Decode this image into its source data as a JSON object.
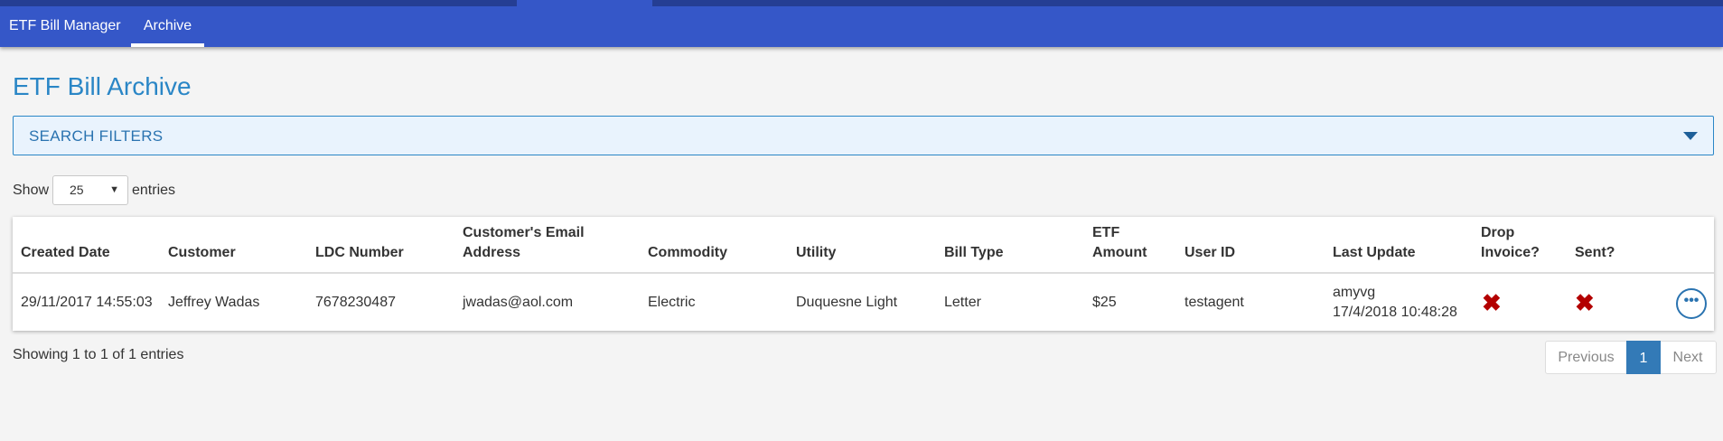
{
  "nav": {
    "brand": "ETF Bill Manager",
    "archive": "Archive"
  },
  "page": {
    "title": "ETF Bill Archive"
  },
  "filters": {
    "label": "SEARCH FILTERS",
    "icon": "caret-down-icon"
  },
  "length": {
    "show": "Show",
    "value": "25",
    "entries": "entries"
  },
  "table": {
    "headers": {
      "created_date": "Created Date",
      "customer": "Customer",
      "ldc": "LDC Number",
      "email_1": "Customer's Email",
      "email_2": "Address",
      "commodity": "Commodity",
      "utility": "Utility",
      "bill_type": "Bill Type",
      "etf_1": "ETF",
      "etf_2": "Amount",
      "user_id": "User ID",
      "last_update": "Last Update",
      "drop_1": "Drop",
      "drop_2": "Invoice?",
      "sent": "Sent?"
    },
    "rows": [
      {
        "created_date": "29/11/2017 14:55:03",
        "customer": "Jeffrey Wadas",
        "ldc": "7678230487",
        "email": "jwadas@aol.com",
        "commodity": "Electric",
        "utility": "Duquesne Light",
        "bill_type": "Letter",
        "etf_amount": "$25",
        "user_id": "testagent",
        "last_update_user": "amyvg",
        "last_update_time": "17/4/2018 10:48:28",
        "drop_invoice": "✖",
        "sent": "✖",
        "more": "•••"
      }
    ]
  },
  "footer": {
    "info": "Showing 1 to 1 of 1 entries",
    "previous": "Previous",
    "current_page": "1",
    "next": "Next"
  },
  "colors": {
    "nav": "#3557c8",
    "nav_strip": "#253e93",
    "accent": "#2a86c6",
    "page_active": "#337ab7",
    "no_mark": "#b30000"
  }
}
